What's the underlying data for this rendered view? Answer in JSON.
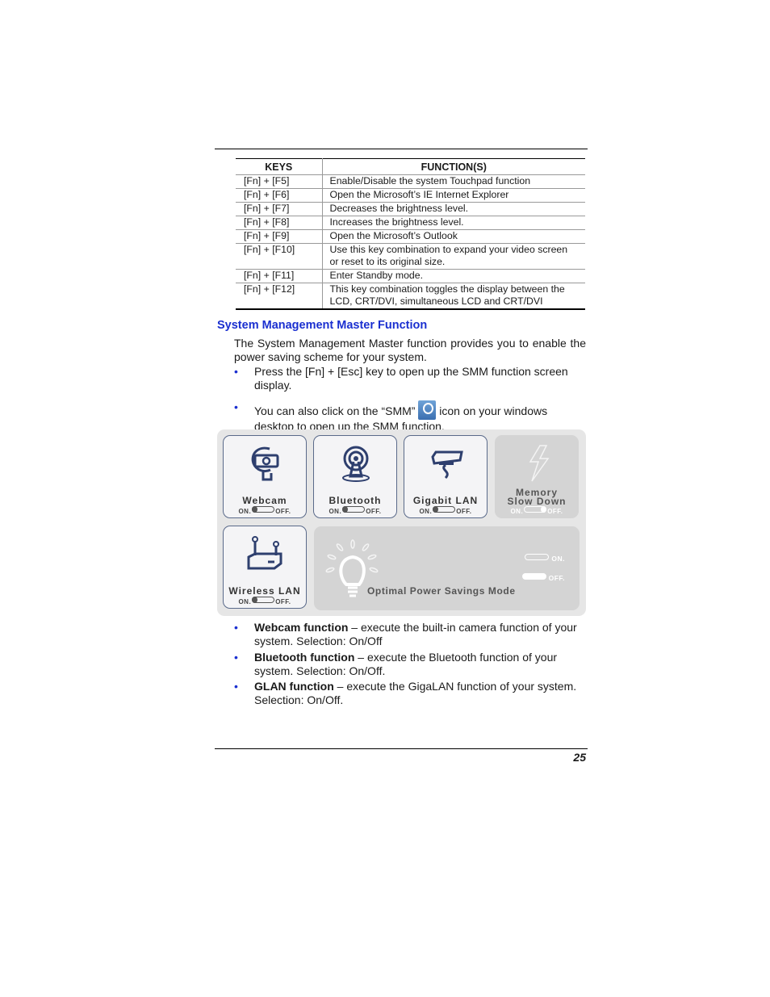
{
  "table": {
    "headers": [
      "KEYS",
      "FUNCTION(S)"
    ],
    "rows": [
      {
        "key": "[Fn] + [F5]",
        "function": "Enable/Disable the system Touchpad function"
      },
      {
        "key": "[Fn] + [F6]",
        "function": "Open the Microsoft’s IE Internet Explorer"
      },
      {
        "key": "[Fn] + [F7]",
        "function": "Decreases the brightness level."
      },
      {
        "key": "[Fn] + [F8]",
        "function": "Increases the brightness level."
      },
      {
        "key": "[Fn] + [F9]",
        "function": "Open the Microsoft’s Outlook"
      },
      {
        "key": "[Fn] + [F10]",
        "function": "Use this key combination to expand your video screen or reset to its original size."
      },
      {
        "key": "[Fn] + [F11]",
        "function": "Enter Standby mode."
      },
      {
        "key": "[Fn] + [F12]",
        "function": "This key combination toggles the display between the LCD, CRT/DVI, simultaneous LCD and CRT/DVI"
      }
    ]
  },
  "section": {
    "title": "System Management Master Function",
    "intro": "The System Management Master function provides you to enable the power saving scheme for your system.",
    "bullets_top": [
      {
        "text": "Press the [Fn] + [Esc] key to open up the SMM function screen display."
      },
      {
        "before": "You can also click on the “SMM” ",
        "icon": "smm-icon",
        "after": " icon on your windows desktop to open up the SMM function."
      }
    ]
  },
  "smm_panel": {
    "tiles": [
      {
        "label": "Webcam",
        "icon": "webcam-icon",
        "on_label": "ON.",
        "off_label": "OFF.",
        "state": "on",
        "enabled": true
      },
      {
        "label": "Bluetooth",
        "icon": "bluetooth-icon",
        "on_label": "ON.",
        "off_label": "OFF.",
        "state": "on",
        "enabled": true
      },
      {
        "label": "Gigabit LAN",
        "icon": "gigabit-lan-icon",
        "on_label": "ON.",
        "off_label": "OFF.",
        "state": "on",
        "enabled": true
      },
      {
        "label_line1": "Memory",
        "label_line2": "Slow Down",
        "icon": "lightning-icon",
        "on_label": "ON.",
        "off_label": "OFF.",
        "state": "off",
        "enabled": false
      },
      {
        "label": "Wireless LAN",
        "icon": "wireless-router-icon",
        "on_label": "ON.",
        "off_label": "OFF.",
        "state": "on",
        "enabled": true
      }
    ],
    "power_mode": {
      "label": "Optimal Power Savings Mode",
      "icon": "lightbulb-icon",
      "on_label": "ON.",
      "off_label": "OFF.",
      "selected": "off"
    }
  },
  "bullets_bottom": [
    {
      "bold": "Webcam function",
      "text": " – execute the built-in camera function of your system. Selection: On/Off"
    },
    {
      "bold": "Bluetooth function",
      "text": " – execute the Bluetooth function of your system. Selection: On/Off."
    },
    {
      "bold": "GLAN function",
      "text": " – execute the GigaLAN function of your system. Selection: On/Off."
    }
  ],
  "footer": {
    "page_number": "25"
  },
  "colors": {
    "heading": "#1a2fd0",
    "bullet": "#1a2fd0",
    "panel_bg": "#e6e6e6",
    "tile_border": "#5a6a8a"
  }
}
